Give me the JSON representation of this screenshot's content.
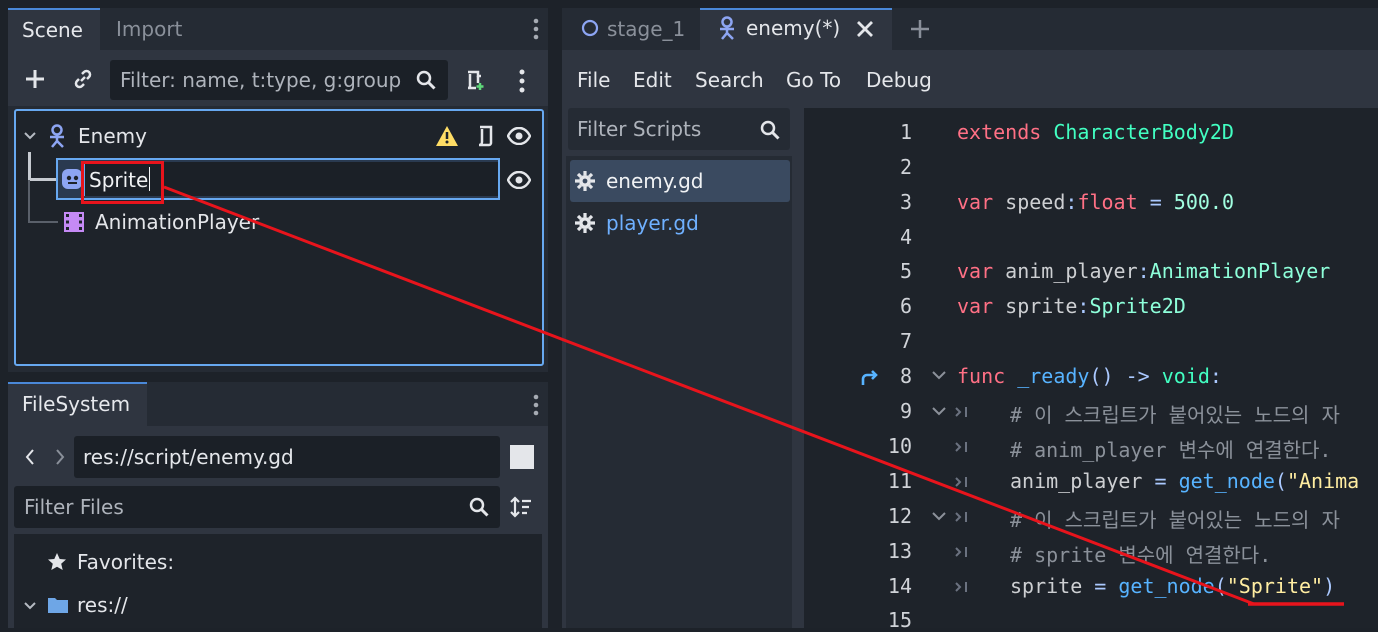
{
  "scene_dock": {
    "tabs": [
      "Scene",
      "Import"
    ],
    "filter_placeholder": "Filter: name, t:type, g:group",
    "tree": {
      "root": "Enemy",
      "children": [
        {
          "label": "Sprite",
          "editing": true
        },
        {
          "label": "AnimationPlayer"
        }
      ]
    }
  },
  "filesystem_dock": {
    "tab": "FileSystem",
    "path": "res://script/enemy.gd",
    "filter_placeholder": "Filter Files",
    "favorites_label": "Favorites:",
    "root_label": "res://"
  },
  "editor": {
    "tabs": [
      {
        "label": "stage_1",
        "active": false
      },
      {
        "label": "enemy(*)",
        "active": true
      }
    ],
    "menu": [
      "File",
      "Edit",
      "Search",
      "Go To",
      "Debug"
    ],
    "filter_scripts_placeholder": "Filter Scripts",
    "scripts": [
      "enemy.gd",
      "player.gd"
    ],
    "line_numbers": [
      "1",
      "2",
      "3",
      "4",
      "5",
      "6",
      "7",
      "8",
      "9",
      "10",
      "11",
      "12",
      "13",
      "14",
      "15"
    ],
    "code": {
      "l1_kw": "extends",
      "l1_ty": "CharacterBody2D",
      "l3_kw": "var",
      "l3_name": "speed",
      "l3_colon": ":",
      "l3_ty": "float",
      "l3_eq": " = ",
      "l3_num": "500.0",
      "l5_kw": "var",
      "l5_name": "anim_player",
      "l5_colon": ":",
      "l5_ty": "AnimationPlayer",
      "l6_kw": "var",
      "l6_name": "sprite",
      "l6_colon": ":",
      "l6_ty": "Sprite2D",
      "l8_kw": "func",
      "l8_name": "_ready",
      "l8_paren": "()",
      "l8_arrow": " -> ",
      "l8_ty": "void",
      "l8_colon": ":",
      "l9_comment": "# 이 스크립트가 붙어있는 노드의 자",
      "l10_comment": "# anim_player 변수에 연결한다.",
      "l11_name": "anim_player",
      "l11_eq": " = ",
      "l11_fn": "get_node",
      "l11_paren": "(",
      "l11_str": "\"Anima",
      "l12_comment": "# 이 스크립트가 붙어있는 노드의 자",
      "l13_comment": "# sprite 변수에 연결한다.",
      "l14_name": "sprite",
      "l14_eq": " = ",
      "l14_fn": "get_node",
      "l14_paren_open": "(",
      "l14_str": "\"Sprite\"",
      "l14_paren_close": ")"
    }
  },
  "colors": {
    "accent": "#4a88d8",
    "annotation_red": "#e8141c",
    "keyword": "#ff7085",
    "type": "#42ffc2",
    "string": "#ffeda1",
    "function": "#57b3ff"
  }
}
